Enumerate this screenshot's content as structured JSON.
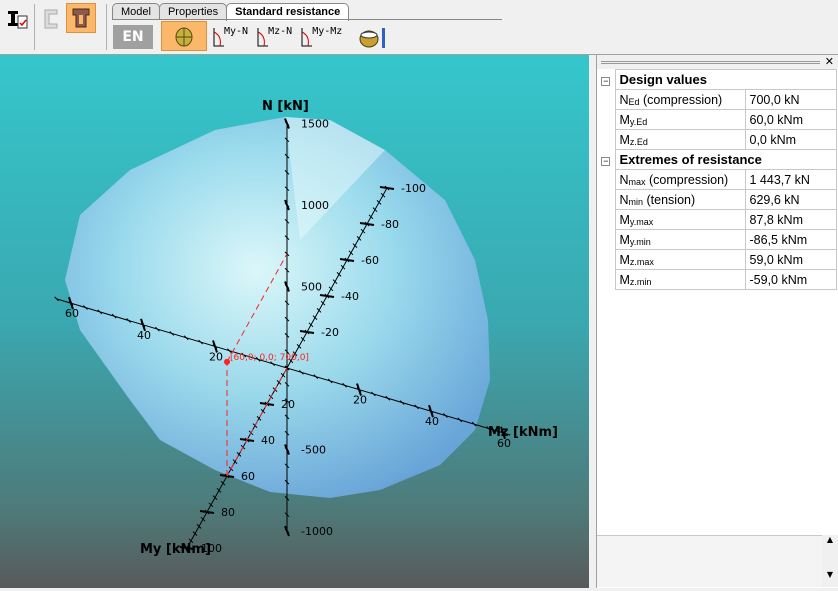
{
  "toolbar": {
    "tabs": [
      "Model",
      "Properties",
      "Standard resistance"
    ],
    "active_tab": "Standard resistance",
    "en_label": "EN",
    "tools": [
      {
        "icon": "interaction-diagram-3d-icon",
        "selected": true
      },
      {
        "icon": "my-n-diagram-icon",
        "label": "My-N"
      },
      {
        "icon": "mz-n-diagram-icon",
        "label": "Mz-N"
      },
      {
        "icon": "my-mz-diagram-icon",
        "label": "My-Mz"
      },
      {
        "icon": "section-cut-icon"
      }
    ]
  },
  "plot": {
    "n_axis_label": "N [kN]",
    "mz_axis_label": "Mz [kNm]",
    "my_axis_label": "My [kNm]",
    "n_ticks": [
      1500,
      1000,
      500,
      -500,
      -1000
    ],
    "mz_ticks": [
      60,
      40,
      20,
      20,
      40,
      60
    ],
    "mz_tick_values": [
      -60,
      -40,
      -20,
      20,
      40,
      60
    ],
    "my_ticks": [
      -100,
      -80,
      -60,
      -40,
      -20,
      20,
      40,
      60,
      80,
      100
    ],
    "design_point_label": "[60,0; 0,0; 700,0]",
    "design_point": {
      "My": 60.0,
      "Mz": 0.0,
      "N": 700.0
    },
    "design_point_color": "#ff2020"
  },
  "panel": {
    "sections": [
      {
        "title": "Design values",
        "rows": [
          {
            "sym": "N",
            "sub": "Ed",
            "suffix": " (compression)",
            "value": "700,0 kN"
          },
          {
            "sym": "M",
            "sub": "y.Ed",
            "suffix": "",
            "value": "60,0 kNm"
          },
          {
            "sym": "M",
            "sub": "z.Ed",
            "suffix": "",
            "value": "0,0 kNm"
          }
        ]
      },
      {
        "title": "Extremes of resistance",
        "rows": [
          {
            "sym": "N",
            "sub": "max",
            "suffix": " (compression)",
            "value": "1 443,7 kN"
          },
          {
            "sym": "N",
            "sub": "min",
            "suffix": " (tension)",
            "value": "629,6 kN"
          },
          {
            "sym": "M",
            "sub": "y.max",
            "suffix": "",
            "value": "87,8 kNm"
          },
          {
            "sym": "M",
            "sub": "y.min",
            "suffix": "",
            "value": "-86,5 kNm"
          },
          {
            "sym": "M",
            "sub": "z.max",
            "suffix": "",
            "value": "59,0 kNm"
          },
          {
            "sym": "M",
            "sub": "z.min",
            "suffix": "",
            "value": "-59,0 kNm"
          }
        ]
      }
    ]
  }
}
